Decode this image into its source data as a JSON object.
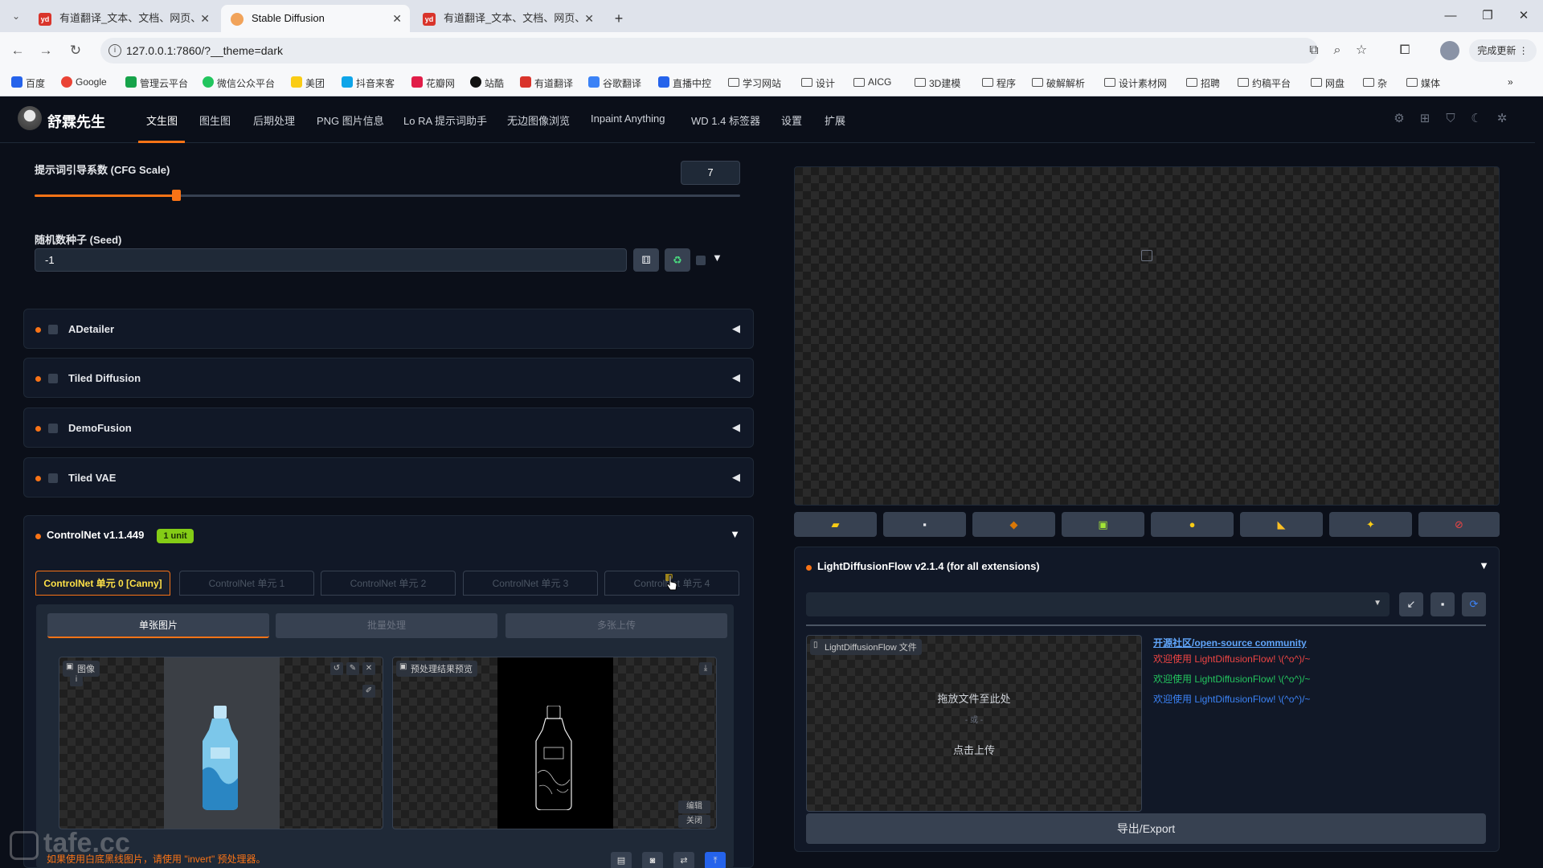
{
  "browser": {
    "tabs": [
      {
        "title": "有道翻译_文本、文档、网页、",
        "icon": "yd"
      },
      {
        "title": "Stable Diffusion",
        "icon": "sd"
      },
      {
        "title": "有道翻译_文本、文档、网页、",
        "icon": "yd"
      }
    ],
    "new_tab": "+",
    "url": "127.0.0.1:7860/?__theme=dark",
    "update_label": "完成更新",
    "bookmarks": [
      "百度",
      "Google",
      "管理云平台",
      "微信公众平台",
      "美团",
      "抖音来客",
      "花瓣网",
      "站酷",
      "有道翻译",
      "谷歌翻译",
      "直播中控",
      "学习网站",
      "设计",
      "AICG",
      "3D建模",
      "程序",
      "破解解析",
      "设计素材网",
      "招聘",
      "约稿平台",
      "网盘",
      "杂",
      "媒体"
    ]
  },
  "app": {
    "brand": "舒霖先生",
    "nav_tabs": [
      "文生图",
      "图生图",
      "后期处理",
      "PNG 图片信息",
      "Lo RA 提示词助手",
      "无边图像浏览",
      "Inpaint Anything",
      "WD 1.4 标签器",
      "设置",
      "扩展"
    ],
    "active_tab": "文生图"
  },
  "params": {
    "cfg_label": "提示词引导系数 (CFG Scale)",
    "cfg_value": "7",
    "cfg_fraction": 0.2,
    "seed_label": "随机数种子 (Seed)",
    "seed_value": "-1"
  },
  "accordions": [
    "ADetailer",
    "Tiled Diffusion",
    "DemoFusion",
    "Tiled VAE"
  ],
  "controlnet": {
    "title": "ControlNet v1.1.449",
    "badge": "1 unit",
    "unit_tabs": [
      "ControlNet 单元 0 [Canny]",
      "ControlNet 单元 1",
      "ControlNet 单元 2",
      "ControlNet 单元 3",
      "ControlNet 单元 4"
    ],
    "sub_tabs": [
      "单张图片",
      "批量处理",
      "多张上传"
    ],
    "image_label": "图像",
    "preview_label": "预处理结果预览",
    "edit_label": "编辑",
    "close_label": "关闭",
    "hint": "如果使用白底黑线图片，请使用 \"invert\" 预处理器。"
  },
  "ldf": {
    "title": "LightDiffusionFlow v2.1.4 (for all extensions)",
    "file_label": "LightDiffusionFlow 文件",
    "drop_text": "拖放文件至此处",
    "or_text": "- 或 -",
    "upload_text": "点击上传",
    "community": "开源社区/open-source community",
    "welcome": [
      "欢迎使用 LightDiffusionFlow! \\(^o^)/~",
      "欢迎使用 LightDiffusionFlow! \\(^o^)/~",
      "欢迎使用 LightDiffusionFlow! \\(^o^)/~"
    ],
    "welcome_colors": [
      "#ef4444",
      "#22c55e",
      "#3b82f6"
    ],
    "export_label": "导出/Export"
  },
  "watermark": "tafe.cc",
  "colors": {
    "accent": "#f97316",
    "badge": "#84cc16",
    "link": "#60a5fa"
  }
}
